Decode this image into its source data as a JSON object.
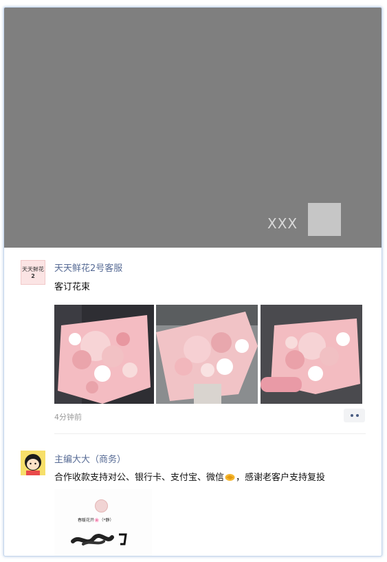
{
  "cover": {
    "name": "XXX"
  },
  "posts": [
    {
      "author": "天天鲜花2号客服",
      "avatar_text": [
        "天天鲜花",
        "2"
      ],
      "text": "客订花束",
      "time": "4分钟前",
      "photos": [
        "bouquet-photo-1",
        "bouquet-photo-2",
        "bouquet-photo-3"
      ]
    },
    {
      "author": "主编大大（商务）",
      "text_before_emoji": "合作收款支持对公、银行卡、支付宝、微信",
      "emoji": "handshake-emoji",
      "text_after_emoji": "，感谢老客户支持复投",
      "attachment": {
        "name_line": "春暖花开🌸（*静）"
      }
    }
  ],
  "colors": {
    "author_link": "#576b95",
    "cover_bg": "#7f7f7f",
    "bouquet_pink": "#f2b7bc"
  },
  "icons": {
    "more": "more-dots-icon"
  }
}
